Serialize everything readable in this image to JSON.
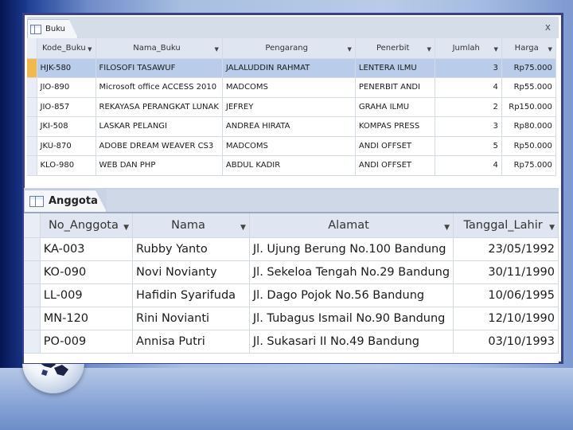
{
  "buku": {
    "tab_label": "Buku",
    "close_label": "x",
    "columns": [
      "Kode_Buku",
      "Nama_Buku",
      "Pengarang",
      "Penerbit",
      "Jumlah",
      "Harga"
    ],
    "rows": [
      [
        "HJK-580",
        "FILOSOFI TASAWUF",
        "JALALUDDIN RAHMAT",
        "LENTERA ILMU",
        "3",
        "Rp75.000"
      ],
      [
        "JIO-890",
        "Microsoft office ACCESS 2010",
        "MADCOMS",
        "PENERBIT ANDI",
        "4",
        "Rp55.000"
      ],
      [
        "JIO-857",
        "REKAYASA PERANGKAT LUNAK",
        "JEFREY",
        "GRAHA ILMU",
        "2",
        "Rp150.000"
      ],
      [
        "JKI-508",
        "LASKAR PELANGI",
        "ANDREA HIRATA",
        "KOMPAS PRESS",
        "3",
        "Rp80.000"
      ],
      [
        "JKU-870",
        "ADOBE DREAM WEAVER CS3",
        "MADCOMS",
        "ANDI OFFSET",
        "5",
        "Rp50.000"
      ],
      [
        "KLO-980",
        "WEB DAN PHP",
        "ABDUL KADIR",
        "ANDI OFFSET",
        "4",
        "Rp75.000"
      ]
    ]
  },
  "anggota": {
    "tab_label": "Anggota",
    "columns": [
      "No_Anggota",
      "Nama",
      "Alamat",
      "Tanggal_Lahir"
    ],
    "rows": [
      [
        "KA-003",
        "Rubby Yanto",
        "Jl. Ujung Berung No.100 Bandung",
        "23/05/1992"
      ],
      [
        "KO-090",
        "Novi Novianty",
        "Jl. Sekeloa Tengah No.29 Bandung",
        "30/11/1990"
      ],
      [
        "LL-009",
        "Hafidin Syarifuda",
        "Jl. Dago Pojok No.56 Bandung",
        "10/06/1995"
      ],
      [
        "MN-120",
        "Rini Novianti",
        "Jl. Tubagus Ismail No.90 Bandung",
        "12/10/1990"
      ],
      [
        "PO-009",
        "Annisa Putri",
        "Jl. Sukasari II No.49 Bandung",
        "03/10/1993"
      ]
    ]
  },
  "colors": {
    "frame_border": "#3b3f8f",
    "selected_row": "#b9cdea",
    "record_selector": "#f4b84a",
    "header_bg": "#dfe6f1"
  }
}
